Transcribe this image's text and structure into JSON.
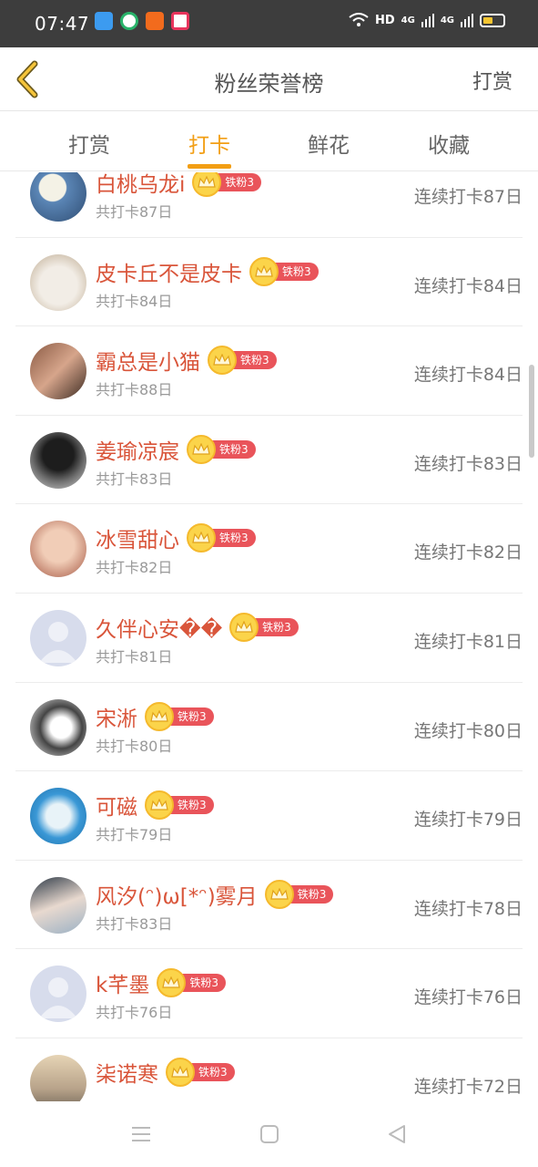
{
  "status_bar": {
    "time": "07:47",
    "network_label": "HD",
    "net_4g_1": "4G",
    "net_4g_2": "4G"
  },
  "header": {
    "title": "粉丝荣誉榜",
    "right_link": "打赏"
  },
  "tabs": [
    {
      "label": "打赏",
      "active": false
    },
    {
      "label": "打卡",
      "active": true
    },
    {
      "label": "鲜花",
      "active": false
    },
    {
      "label": "收藏",
      "active": false
    }
  ],
  "badge_label": "铁粉3",
  "rows": [
    {
      "name": "白桃乌龙i",
      "total": "共打卡87日",
      "streak": "连续打卡87日",
      "avatar": "photo-blue-flower"
    },
    {
      "name": "皮卡丘不是皮卡",
      "total": "共打卡84日",
      "streak": "连续打卡84日",
      "avatar": "photo-white-cat"
    },
    {
      "name": "霸总是小猫",
      "total": "共打卡88日",
      "streak": "连续打卡84日",
      "avatar": "photo-couple"
    },
    {
      "name": "姜瑜凉宸",
      "total": "共打卡83日",
      "streak": "连续打卡83日",
      "avatar": "photo-dark-figure"
    },
    {
      "name": "冰雪甜心",
      "total": "共打卡82日",
      "streak": "连续打卡82日",
      "avatar": "photo-baby"
    },
    {
      "name": "久伴心安��",
      "total": "共打卡81日",
      "streak": "连续打卡81日",
      "avatar": "default-avatar"
    },
    {
      "name": "宋淅",
      "total": "共打卡80日",
      "streak": "连续打卡80日",
      "avatar": "photo-sketch-girl"
    },
    {
      "name": "可磁",
      "total": "共打卡79日",
      "streak": "连续打卡79日",
      "avatar": "photo-blue-cartoon"
    },
    {
      "name": "风汐(ᵔ)ω[*ᵔ)雾月",
      "total": "共打卡83日",
      "streak": "连续打卡78日",
      "avatar": "photo-girl-portrait"
    },
    {
      "name": "k芊墨",
      "total": "共打卡76日",
      "streak": "连续打卡76日",
      "avatar": "default-avatar"
    },
    {
      "name": "柒诺寒",
      "total": "",
      "streak": "连续打卡72日",
      "avatar": "photo-landscape"
    }
  ],
  "colors": {
    "accent": "#f29e14",
    "name": "#d9553a",
    "badge": "#e9545a",
    "status_bar": "#3d3d3d"
  }
}
